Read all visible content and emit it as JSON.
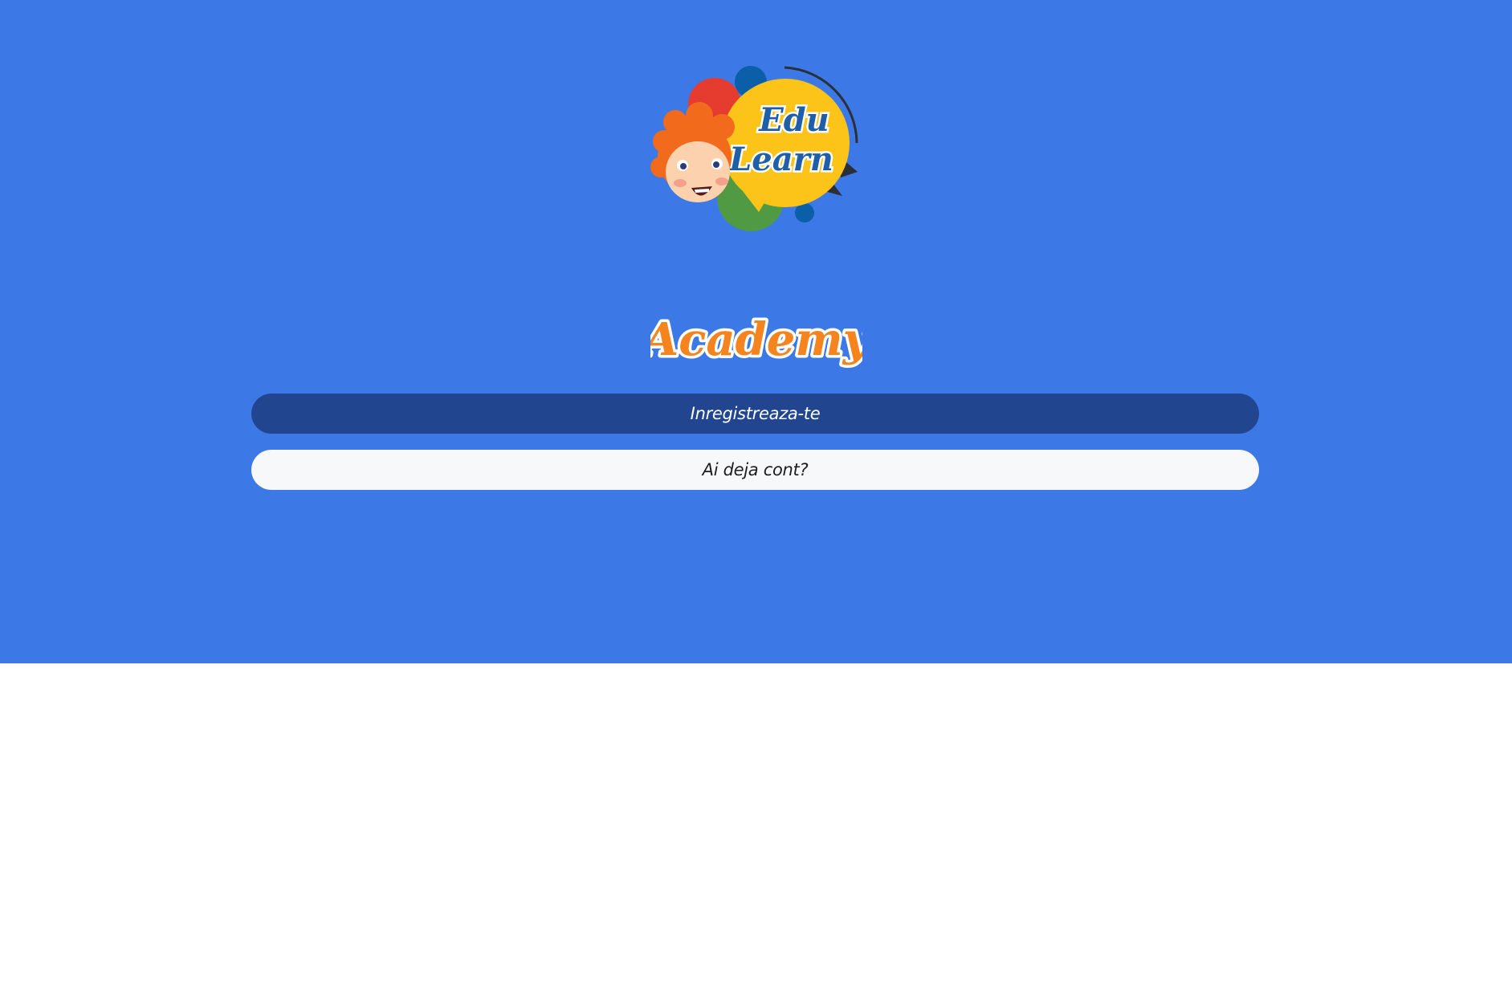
{
  "brand": {
    "logo_line1": "Edu",
    "logo_line2": "Learn",
    "wordmark": "Academy"
  },
  "actions": {
    "register_label": "Inregistreaza-te",
    "login_label": "Ai deja cont?"
  },
  "colors": {
    "hero_background": "#3d79e6",
    "register_button": "#21468f",
    "login_button": "#f6f8f9",
    "logo_bubble": "#fcc419",
    "logo_text": "#1f5fa8",
    "wordmark": "#f5841f"
  },
  "icons": {
    "logo": "edulearn-logo-icon",
    "wordmark": "academy-wordmark-icon"
  }
}
